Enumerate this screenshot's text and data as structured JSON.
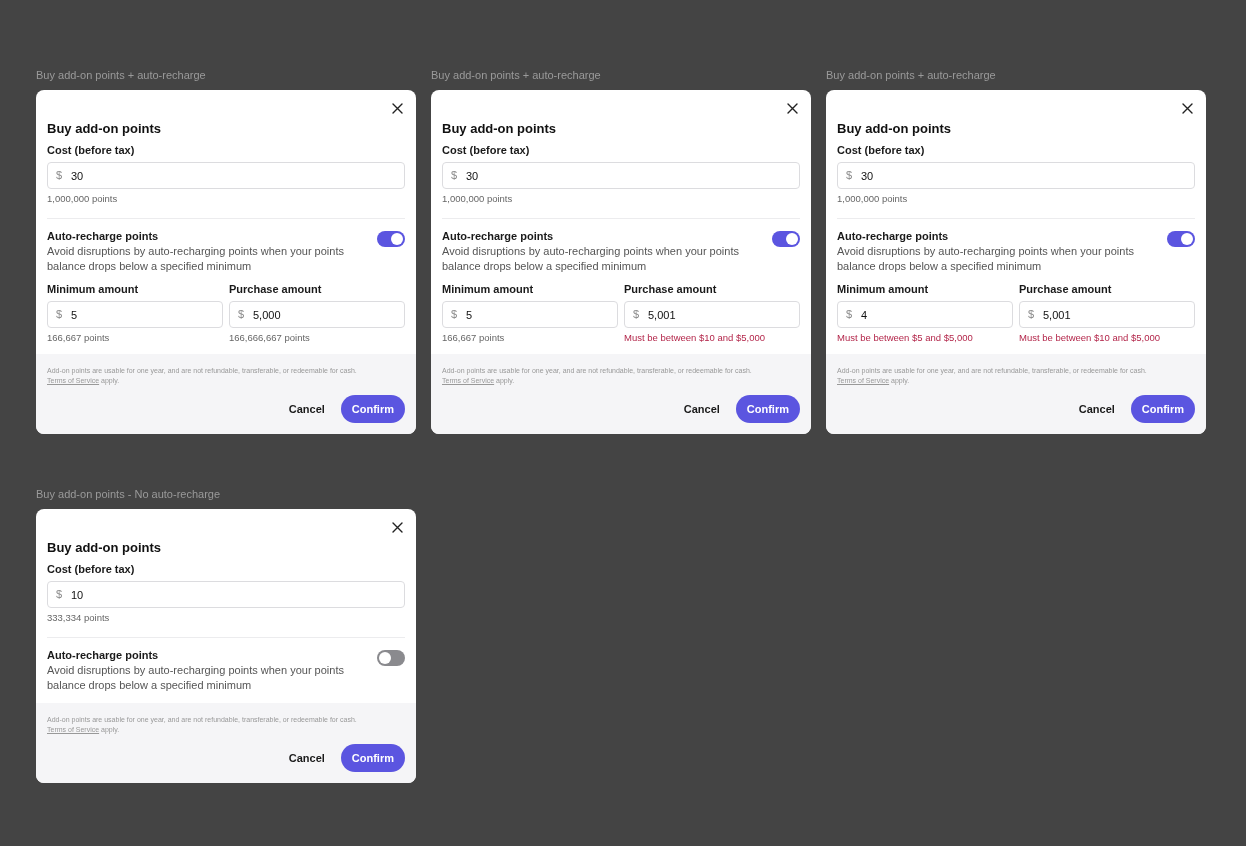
{
  "frames": [
    {
      "label": "Buy add-on points + auto-recharge",
      "dialog": {
        "title": "Buy add-on points",
        "cost": {
          "label": "Cost (before tax)",
          "currency": "$",
          "value": "30",
          "note": "1,000,000 points"
        },
        "auto_recharge": {
          "title": "Auto-recharge points",
          "description": "Avoid disruptions by auto-recharging points when your points balance drops below a specified minimum",
          "on": true
        },
        "amounts": [
          {
            "label": "Minimum amount",
            "currency": "$",
            "value": "5",
            "hint": "166,667 points",
            "kind": "note"
          },
          {
            "label": "Purchase amount",
            "currency": "$",
            "value": "5,000",
            "hint": "166,666,667 points",
            "kind": "note"
          }
        ],
        "disclaimer": {
          "text": "Add-on points are usable for one year, and are not refundable, transferable, or redeemable for cash.",
          "link": "Terms of Service",
          "suffix": "apply."
        },
        "buttons": {
          "cancel": "Cancel",
          "confirm": "Confirm"
        }
      }
    },
    {
      "label": "Buy add-on points + auto-recharge",
      "dialog": {
        "title": "Buy add-on points",
        "cost": {
          "label": "Cost (before tax)",
          "currency": "$",
          "value": "30",
          "note": "1,000,000 points"
        },
        "auto_recharge": {
          "title": "Auto-recharge points",
          "description": "Avoid disruptions by auto-recharging points when your points balance drops below a specified minimum",
          "on": true
        },
        "amounts": [
          {
            "label": "Minimum amount",
            "currency": "$",
            "value": "5",
            "hint": "166,667 points",
            "kind": "note"
          },
          {
            "label": "Purchase amount",
            "currency": "$",
            "value": "5,001",
            "hint": "Must be between $10 and $5,000",
            "kind": "error"
          }
        ],
        "disclaimer": {
          "text": "Add-on points are usable for one year, and are not refundable, transferable, or redeemable for cash.",
          "link": "Terms of Service",
          "suffix": "apply."
        },
        "buttons": {
          "cancel": "Cancel",
          "confirm": "Confirm"
        }
      }
    },
    {
      "label": "Buy add-on points + auto-recharge",
      "dialog": {
        "title": "Buy add-on points",
        "cost": {
          "label": "Cost (before tax)",
          "currency": "$",
          "value": "30",
          "note": "1,000,000 points"
        },
        "auto_recharge": {
          "title": "Auto-recharge points",
          "description": "Avoid disruptions by auto-recharging points when your points balance drops below a specified minimum",
          "on": true
        },
        "amounts": [
          {
            "label": "Minimum amount",
            "currency": "$",
            "value": "4",
            "hint": "Must be between $5 and $5,000",
            "kind": "error"
          },
          {
            "label": "Purchase amount",
            "currency": "$",
            "value": "5,001",
            "hint": "Must be between $10 and $5,000",
            "kind": "error"
          }
        ],
        "disclaimer": {
          "text": "Add-on points are usable for one year, and are not refundable, transferable, or redeemable for cash.",
          "link": "Terms of Service",
          "suffix": "apply."
        },
        "buttons": {
          "cancel": "Cancel",
          "confirm": "Confirm"
        }
      }
    },
    {
      "label": "Buy add-on points - No auto-recharge",
      "dialog": {
        "title": "Buy add-on points",
        "cost": {
          "label": "Cost (before tax)",
          "currency": "$",
          "value": "10",
          "note": "333,334 points"
        },
        "auto_recharge": {
          "title": "Auto-recharge points",
          "description": "Avoid disruptions by auto-recharging points when your points balance drops below a specified minimum",
          "on": false
        },
        "disclaimer": {
          "text": "Add-on points are usable for one year, and are not refundable, transferable, or redeemable for cash.",
          "link": "Terms of Service",
          "suffix": "apply."
        },
        "buttons": {
          "cancel": "Cancel",
          "confirm": "Confirm"
        }
      }
    }
  ]
}
